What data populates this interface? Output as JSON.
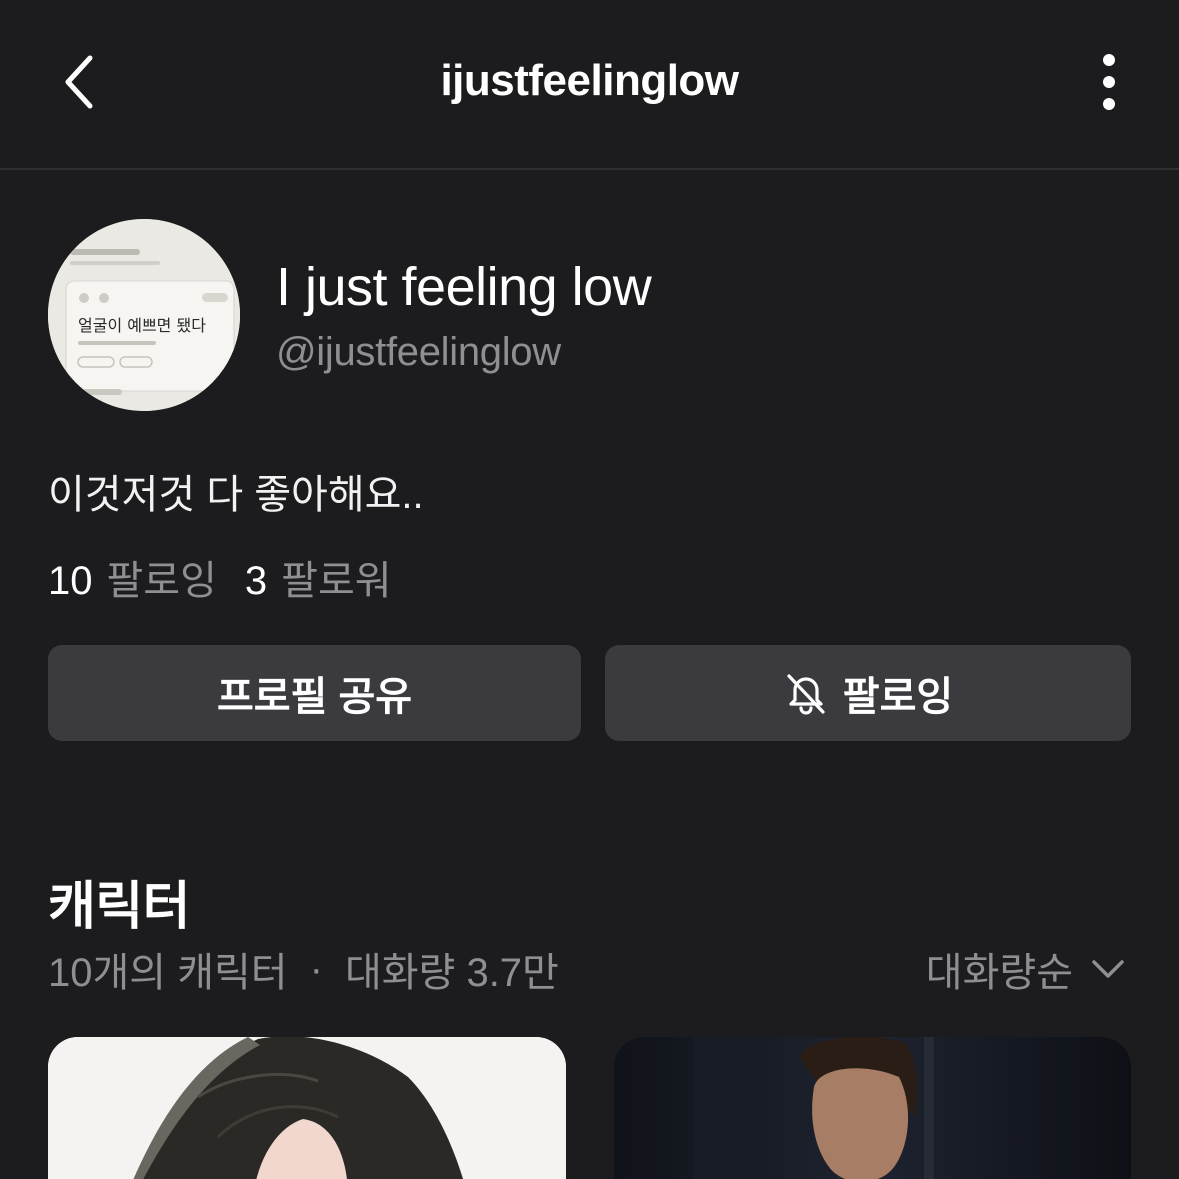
{
  "header": {
    "title": "ijustfeelinglow",
    "back_icon": "chevron-left-icon",
    "more_icon": "more-vertical-icon"
  },
  "profile": {
    "avatar_text": "얼굴이 예쁘면 됐다",
    "display_name": "I just feeling low",
    "handle": "@ijustfeelinglow",
    "bio": "이것저것 다 좋아해요..",
    "following_count": "10",
    "following_label": "팔로잉",
    "followers_count": "3",
    "followers_label": "팔로워"
  },
  "actions": {
    "share_label": "프로필 공유",
    "follow_label": "팔로잉",
    "follow_icon": "bell-off-icon"
  },
  "characters": {
    "title": "캐릭터",
    "count_text": "10개의 캐릭터",
    "separator": "·",
    "volume_text": "대화량 3.7만",
    "sort_label": "대화량순",
    "sort_icon": "chevron-down-icon"
  },
  "colors": {
    "background": "#1c1c1e",
    "button": "#3a3a3f",
    "muted_text": "#8e8e93"
  }
}
